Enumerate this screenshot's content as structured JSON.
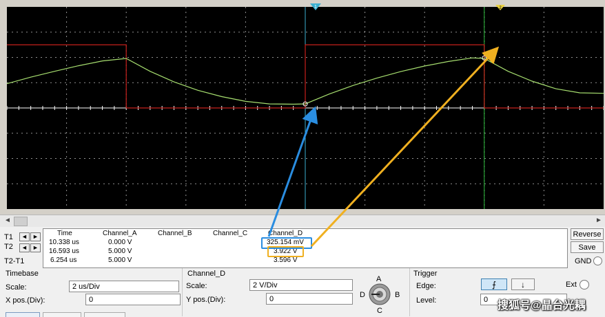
{
  "readout": {
    "headers": [
      "Time",
      "Channel_A",
      "Channel_B",
      "Channel_C",
      "Channel_D"
    ],
    "rows": [
      {
        "label": "T1",
        "time": "10.338 us",
        "a": "0.000 V",
        "d": "325.154 mV"
      },
      {
        "label": "T2",
        "time": "16.593 us",
        "a": "5.000 V",
        "d": "3.922 V"
      },
      {
        "label": "T2-T1",
        "time": "6.254 us",
        "a": "5.000 V",
        "d": "3.596 V"
      }
    ],
    "arrow_left": "◄",
    "arrow_right": "►"
  },
  "buttons": {
    "reverse": "Reverse",
    "save": "Save",
    "gnd": "GND"
  },
  "timebase": {
    "title": "Timebase",
    "scale_label": "Scale:",
    "scale_value": "2 us/Div",
    "xpos_label": "X pos.(Div):",
    "xpos_value": "0"
  },
  "channel": {
    "title": "Channel_D",
    "scale_label": "Scale:",
    "scale_value": "2  V/Div",
    "ypos_label": "Y pos.(Div):",
    "ypos_value": "0",
    "knob_labels": {
      "a": "A",
      "b": "B",
      "c": "C",
      "d": "D"
    }
  },
  "trigger": {
    "title": "Trigger",
    "edge_label": "Edge:",
    "level_label": "Level:",
    "level_value": "0",
    "ext_label": "Ext",
    "rise_icon": "⨍",
    "fall_icon": "↓"
  },
  "watermark": "搜狐号@晶台光耦",
  "colors": {
    "screen": "#000000",
    "grid": "#d0d0d0",
    "channel_a": "#c8201c",
    "channel_d": "#a8e070",
    "cursor_t1": "#3bb0d0",
    "cursor_t2": "#2dbf3d",
    "annot_blue": "#2a8de0",
    "annot_yellow": "#f0b020"
  },
  "chart_data": {
    "type": "line",
    "xlim_div": [
      0,
      10
    ],
    "ylim_div": [
      -4,
      4
    ],
    "cursors": {
      "t1_us": 10.338,
      "t2_us": 16.593
    },
    "series": [
      {
        "name": "Channel_A",
        "x": [
          0,
          2.0,
          2.0,
          5.0,
          5.0,
          8.0,
          8.0,
          10.0
        ],
        "y": [
          2.5,
          2.5,
          0,
          0,
          2.5,
          2.5,
          0,
          0
        ]
      },
      {
        "name": "Channel_D",
        "x": [
          0,
          0.4,
          0.8,
          1.2,
          1.6,
          2.0,
          2.4,
          2.8,
          3.2,
          3.6,
          4.0,
          4.4,
          4.8,
          5.0,
          5.4,
          5.8,
          6.2,
          6.6,
          7.0,
          7.4,
          7.8,
          8.0,
          8.4,
          8.8,
          9.2,
          9.6,
          10.0
        ],
        "y": [
          0.96,
          1.22,
          1.45,
          1.67,
          1.86,
          1.96,
          1.45,
          1.03,
          0.7,
          0.45,
          0.26,
          0.16,
          0.15,
          0.16,
          0.55,
          0.89,
          1.18,
          1.44,
          1.66,
          1.84,
          1.98,
          1.96,
          1.45,
          1.06,
          0.76,
          0.6,
          0.58
        ]
      }
    ]
  }
}
